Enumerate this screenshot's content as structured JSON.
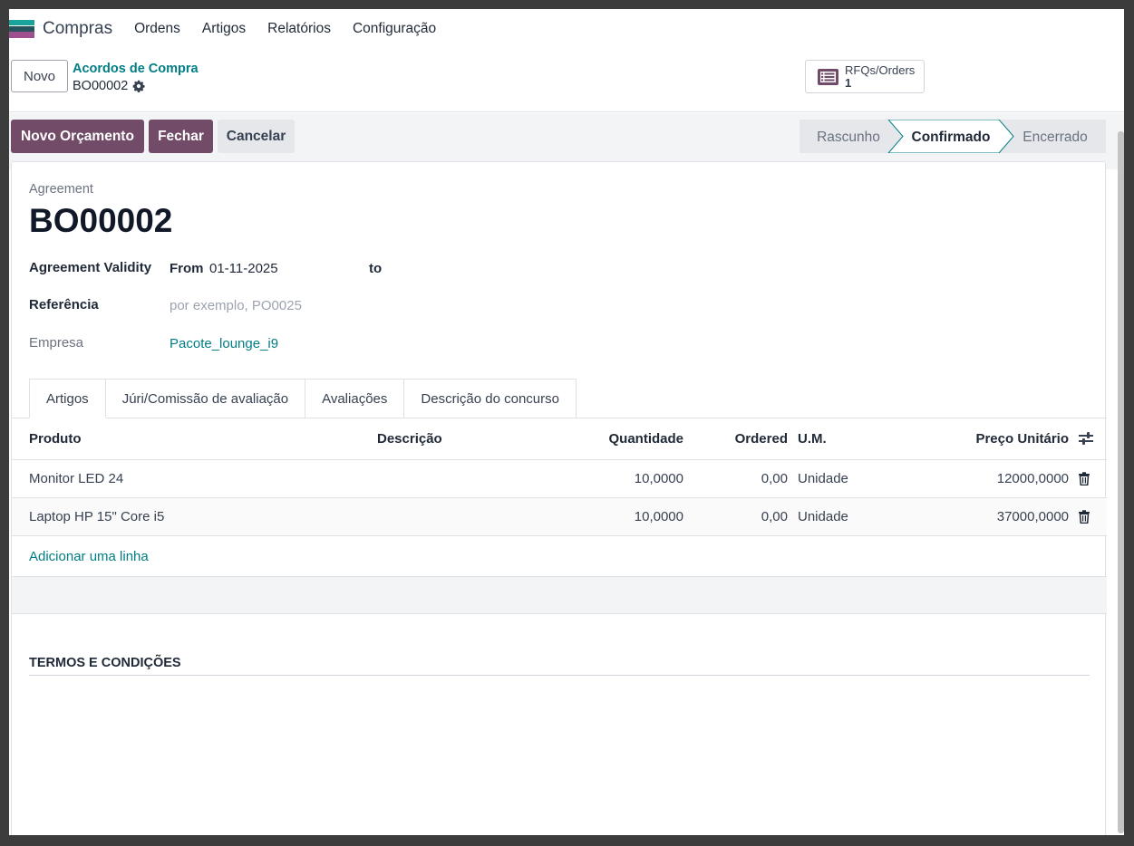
{
  "navbar": {
    "app_name": "Compras",
    "menu": [
      "Ordens",
      "Artigos",
      "Relatórios",
      "Configuração"
    ]
  },
  "control": {
    "new_label": "Novo",
    "breadcrumb": "Acordos de Compra",
    "record": "BO00002",
    "smart_button": {
      "label": "RFQs/Orders",
      "count": "1"
    }
  },
  "statusbar": {
    "buttons": [
      "Novo Orçamento",
      "Fechar",
      "Cancelar"
    ],
    "stages": [
      "Rascunho",
      "Confirmado",
      "Encerrado"
    ],
    "active_stage": "Confirmado"
  },
  "form": {
    "small_label": "Agreement",
    "title": "BO00002",
    "validity_label": "Agreement Validity",
    "from_label": "From",
    "from_value": "01-11-2025",
    "to_label": "to",
    "reference_label": "Referência",
    "reference_placeholder": "por exemplo, PO0025",
    "company_label": "Empresa",
    "company_value": "Pacote_lounge_i9"
  },
  "tabs": [
    "Artigos",
    "Júri/Comissão de avaliação",
    "Avaliações",
    "Descrição do concurso"
  ],
  "lines": {
    "headers": [
      "Produto",
      "Descrição",
      "Quantidade",
      "Ordered",
      "U.M.",
      "Preço Unitário"
    ],
    "rows": [
      {
        "product": "Monitor LED 24",
        "description": "",
        "quantity": "10,0000",
        "ordered": "0,00",
        "uom": "Unidade",
        "price": "12000,0000"
      },
      {
        "product": "Laptop HP 15\" Core i5",
        "description": "",
        "quantity": "10,0000",
        "ordered": "0,00",
        "uom": "Unidade",
        "price": "37000,0000"
      }
    ],
    "add_line": "Adicionar uma linha"
  },
  "terms_label": "TERMOS E CONDIÇÕES",
  "colors": {
    "primary": "#714b67",
    "link": "#017e84"
  }
}
